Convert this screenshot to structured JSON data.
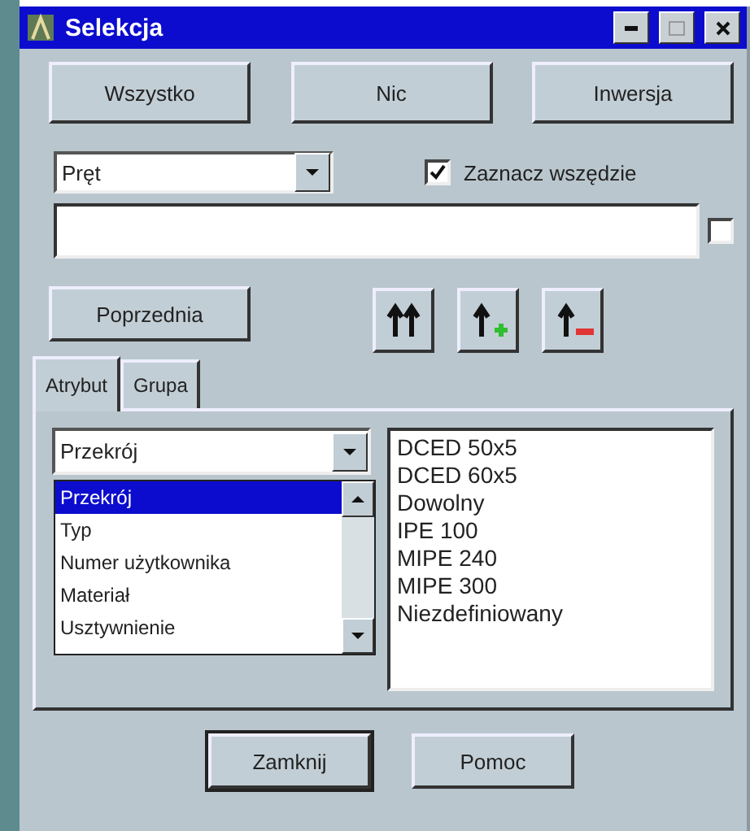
{
  "window": {
    "title": "Selekcja"
  },
  "top_buttons": [
    "Wszystko",
    "Nic",
    "Inwersja"
  ],
  "type_combo": {
    "value": "Pręt"
  },
  "select_everywhere": {
    "label": "Zaznacz wszędzie",
    "checked": true
  },
  "filter_checkbox": {
    "checked": false
  },
  "previous_button": "Poprzednia",
  "tabs": [
    {
      "label": "Atrybut",
      "selected": true
    },
    {
      "label": "Grupa",
      "selected": false
    }
  ],
  "attribute_combo": {
    "value": "Przekrój",
    "expanded": true
  },
  "attribute_options": [
    {
      "label": "Przekrój",
      "selected": true
    },
    {
      "label": "Typ",
      "selected": false
    },
    {
      "label": "Numer użytkownika",
      "selected": false
    },
    {
      "label": "Materiał",
      "selected": false
    },
    {
      "label": "Usztywnienie",
      "selected": false
    }
  ],
  "values_list": [
    "DCED 50x5",
    "DCED 60x5",
    "Dowolny",
    "IPE 100",
    "MIPE 240",
    "MIPE 300",
    "Niezdefiniowany"
  ],
  "bottom_buttons": [
    {
      "label": "Zamknij",
      "default": true
    },
    {
      "label": "Pomoc",
      "default": false
    }
  ]
}
